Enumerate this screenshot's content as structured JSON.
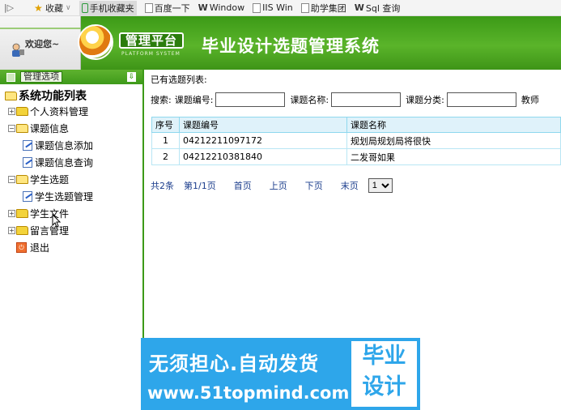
{
  "bookmarks": {
    "items": [
      {
        "label": "收藏",
        "icon": "star-icon"
      },
      {
        "label": "手机收藏夹",
        "icon": "phone-icon"
      },
      {
        "label": "百度一下",
        "icon": "page-icon"
      },
      {
        "label": "Window",
        "icon": "w-logo-icon"
      },
      {
        "label": "IIS Win",
        "icon": "page-icon"
      },
      {
        "label": "助学集团",
        "icon": "page-icon"
      },
      {
        "label": "Sql 查询",
        "icon": "w-logo-icon"
      }
    ]
  },
  "header": {
    "welcome": "欢迎您~",
    "platform": "管理平台",
    "platform_sub": "PLATFORM SYSTEM",
    "title": "毕业设计选题管理系统"
  },
  "sidebar": {
    "options_label": "管理选项",
    "root": "系统功能列表",
    "items": [
      {
        "label": "个人资料管理"
      },
      {
        "label": "课题信息"
      },
      {
        "label": "课题信息添加"
      },
      {
        "label": "课题信息查询"
      },
      {
        "label": "学生选题"
      },
      {
        "label": "学生选题管理"
      },
      {
        "label": "学生文件"
      },
      {
        "label": "留言管理"
      },
      {
        "label": "退出"
      }
    ]
  },
  "main": {
    "list_title": "已有选题列表:",
    "search": {
      "label": "搜索:",
      "field1": "课题编号:",
      "field2": "课题名称:",
      "field3": "课题分类:",
      "field4": "教师"
    },
    "table": {
      "headers": [
        "序号",
        "课题编号",
        "课题名称"
      ],
      "rows": [
        [
          "1",
          "04212211097172",
          "规划局规划局将很快"
        ],
        [
          "2",
          "04212210381840",
          "二发哥如果"
        ]
      ]
    },
    "pager": {
      "total": "共2条",
      "page_info": "第1/1页",
      "first": "首页",
      "prev": "上页",
      "next": "下页",
      "last": "末页",
      "select_value": "1"
    }
  },
  "watermark": {
    "line1": "无须担心.自动发货",
    "line2": "www.51topmind.com",
    "box_line1": "毕业",
    "box_line2": "设计"
  },
  "colors": {
    "header_green": "#4aa81f",
    "table_border": "#8fd8ee",
    "watermark_blue": "#2ea6ea"
  }
}
